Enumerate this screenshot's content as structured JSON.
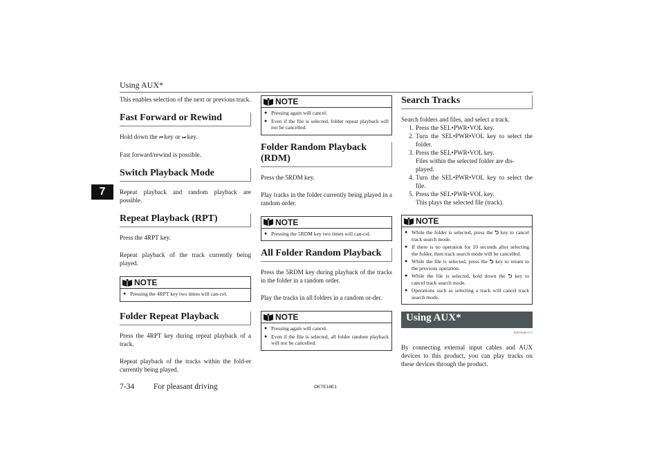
{
  "header": {
    "running_title": "Using AUX*"
  },
  "side_tab": {
    "chapter": "7"
  },
  "footer": {
    "page_number": "7-34",
    "section": "For pleasant driving",
    "doc_code": "OKTE18E1"
  },
  "col1": {
    "intro": "This enables selection of the next or previous track.",
    "ffr": {
      "heading": "Fast Forward or Rewind",
      "p1_pre": "Hold down the ",
      "prev_key_icon": "⏮",
      "p1_mid": " key or ",
      "next_key_icon": "⏭",
      "p1_post": " key.",
      "p2": "Fast forward/rewind is possible."
    },
    "switch": {
      "heading": "Switch Playback Mode",
      "p1": "Repeat playback and random playback are possible."
    },
    "rpt": {
      "heading": "Repeat Playback (RPT)",
      "p1": "Press the 4RPT key.",
      "p2": "Repeat playback of the track currently being played.",
      "note_title": "NOTE",
      "notes": [
        "Pressing the 4RPT key two times will can-cel."
      ]
    },
    "folder_repeat": {
      "heading": "Folder Repeat Playback",
      "p1": "Press the 4RPT key during repeat playback of a track.",
      "p2": "Repeat playback of the tracks within the fold-er currently being played."
    }
  },
  "col2": {
    "note1": {
      "title": "NOTE",
      "items": [
        "Pressing again will cancel.",
        "Even if the file is selected, folder repeat playback will not be cancelled."
      ]
    },
    "rdm": {
      "heading": "Folder Random Playback (RDM)",
      "p1": "Press the 5RDM key.",
      "p2": "Play tracks in the folder currently being played in a random order.",
      "note_title": "NOTE",
      "notes": [
        "Pressing the 5RDM key two times will can-cel."
      ]
    },
    "all_rdm": {
      "heading": "All Folder Random Playback",
      "p1": "Press the 5RDM key during playback of the tracks in the folder in a random order.",
      "p2": "Play the tracks in all folders in a random or-der.",
      "note_title": "NOTE",
      "notes": [
        "Pressing again will cancel.",
        "Even if the file is selected, all folder random playback will not be cancelled."
      ]
    }
  },
  "col3": {
    "search": {
      "heading": "Search Tracks",
      "intro": "Search folders and files, and select a track.",
      "steps": [
        {
          "num": "1.",
          "text": "Press the SEL•PWR•VOL key.",
          "sub": ""
        },
        {
          "num": "2.",
          "text": "Turn the SEL•PWR•VOL key to select the folder.",
          "sub": ""
        },
        {
          "num": "3.",
          "text": "Press the SEL•PWR•VOL key.",
          "sub": "Files within the selected folder are dis-played."
        },
        {
          "num": "4.",
          "text": "Turn the SEL•PWR•VOL key to select the file.",
          "sub": ""
        },
        {
          "num": "5.",
          "text": "Press the SEL•PWR•VOL key.",
          "sub": "This plays the selected file (track)."
        }
      ],
      "note_title": "NOTE",
      "back_key_icon": "⮌",
      "notes": [
        {
          "pre": "While the folder is selected, press the ",
          "post": " key to cancel track search mode."
        },
        {
          "pre": "If there is no operation for 10 seconds after selecting the folder, then track search mode will be cancelled.",
          "post": ""
        },
        {
          "pre": "While the file is selected, press the ",
          "post": " key to return to the previous operation."
        },
        {
          "pre": "While the file is selected, hold down the ",
          "post": " key to cancel track search mode."
        },
        {
          "pre": "Operations such as selecting a track will cancel track search mode.",
          "post": ""
        }
      ]
    },
    "aux": {
      "heading": "Using AUX*",
      "code": "E00736901177",
      "p1": "By connecting external input cables and AUX devices to this product, you can play tracks on these devices through the product."
    }
  },
  "colors": {
    "banner": "#4d5756",
    "side_tab": "#111111"
  }
}
